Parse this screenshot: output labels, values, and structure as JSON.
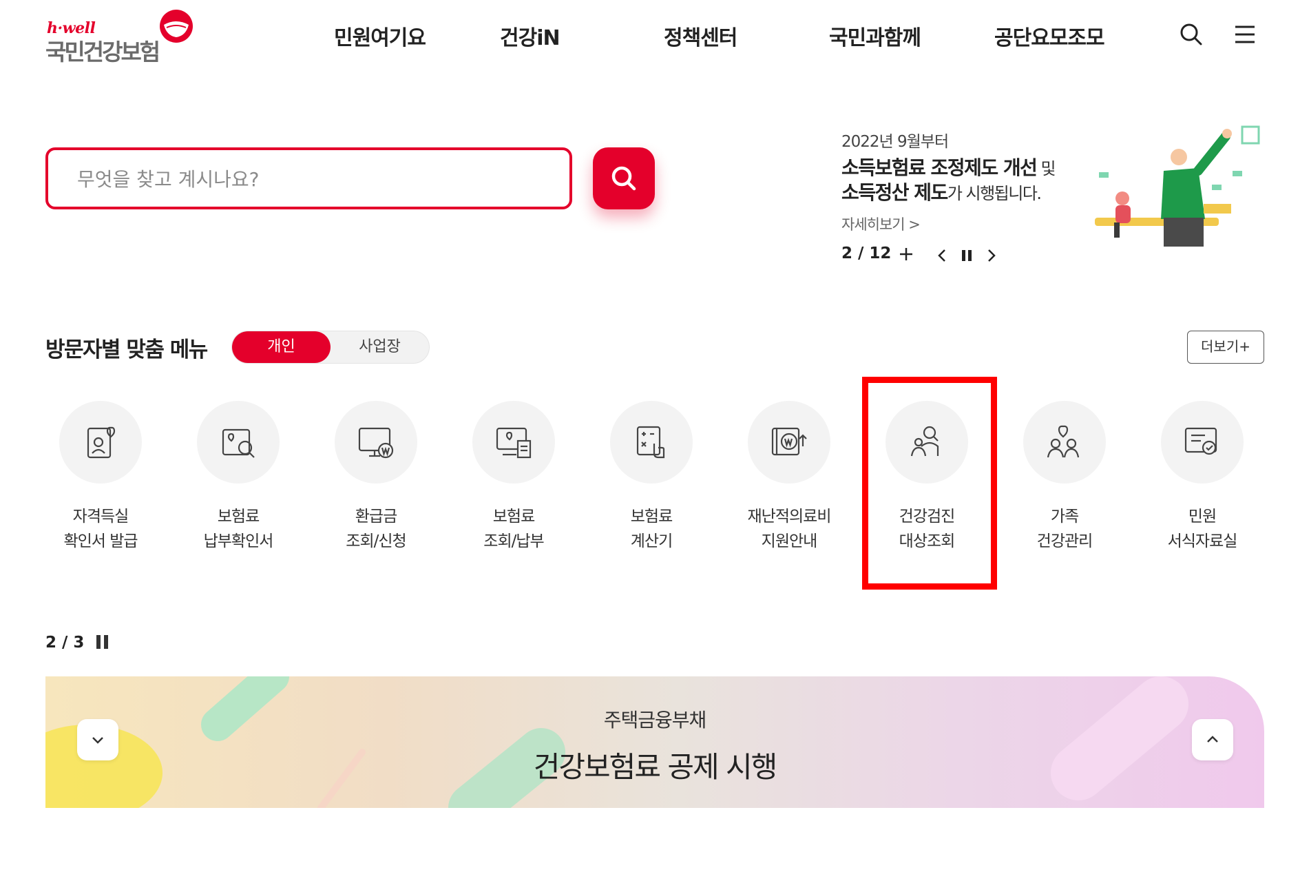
{
  "header": {
    "logo_brand": "h·well",
    "logo_name": "국민건강보험",
    "nav": [
      "민원여기요",
      "건강iN",
      "정책센터",
      "국민과함께",
      "공단요모조모"
    ]
  },
  "search": {
    "placeholder": "무엇을 찾고 계시나요?",
    "value": ""
  },
  "promo": {
    "date": "2022년 9월부터",
    "line1_bold": "소득보험료 조정제도 개선",
    "line1_light": " 및",
    "line2_bold": "소득정산 제도",
    "line2_light": "가 시행됩니다.",
    "more": "자세히보기 >",
    "pager": "2 / 12"
  },
  "visitor_menu": {
    "title": "방문자별 맞춤 메뉴",
    "tab_active": "개인",
    "tab_inactive": "사업장",
    "more": "더보기+",
    "items": [
      {
        "line1": "자격득실",
        "line2": "확인서 발급",
        "icon": "qualification-certificate-icon"
      },
      {
        "line1": "보험료",
        "line2": "납부확인서",
        "icon": "premium-payment-confirm-icon"
      },
      {
        "line1": "환급금",
        "line2": "조회/신청",
        "icon": "refund-inquiry-icon"
      },
      {
        "line1": "보험료",
        "line2": "조회/납부",
        "icon": "premium-inquiry-payment-icon"
      },
      {
        "line1": "보험료",
        "line2": "계산기",
        "icon": "premium-calculator-icon"
      },
      {
        "line1": "재난적의료비",
        "line2": "지원안내",
        "icon": "catastrophic-medical-support-icon"
      },
      {
        "line1": "건강검진",
        "line2": "대상조회",
        "icon": "health-checkup-target-icon"
      },
      {
        "line1": "가족",
        "line2": "건강관리",
        "icon": "family-health-management-icon"
      },
      {
        "line1": "민원",
        "line2": "서식자료실",
        "icon": "civil-forms-library-icon"
      }
    ],
    "pager": "2 / 3"
  },
  "banner": {
    "sub": "주택금융부채",
    "main": "건강보험료 공제 시행"
  },
  "colors": {
    "brand_red": "#e4002b",
    "highlight": "#ff0000"
  }
}
